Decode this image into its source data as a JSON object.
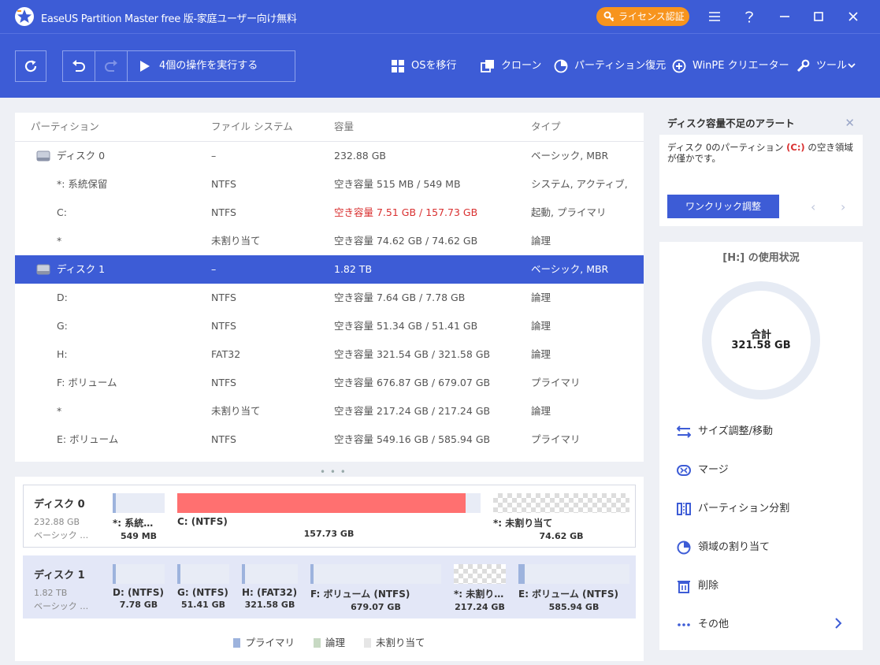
{
  "app": {
    "title": "EaseUS Partition Master free 版-家庭ユーザー向け無料",
    "license_label": "ライセンス認証"
  },
  "toolbar": {
    "execute_label": "4個の操作を実行する",
    "items": {
      "os_migrate": "OSを移行",
      "clone": "クローン",
      "partition_recovery": "パーティション復元",
      "winpe": "WinPE クリエーター",
      "tools": "ツール"
    }
  },
  "table": {
    "headers": {
      "partition": "パーティション",
      "filesystem": "ファイル システム",
      "capacity": "容量",
      "type": "タイプ"
    },
    "rows": [
      {
        "name": "ディスク 0",
        "fs": "–",
        "cap": "232.88 GB",
        "type": "ベーシック, MBR",
        "disk": true
      },
      {
        "name": "*: 系統保留",
        "fs": "NTFS",
        "cap": "空き容量 515 MB / 549 MB",
        "type": "システム, アクティブ, …"
      },
      {
        "name": "C:",
        "fs": "NTFS",
        "cap": "空き容量 7.51 GB / 157.73 GB",
        "type": "起動, プライマリ",
        "warn": true
      },
      {
        "name": "*",
        "fs": "未割り当て",
        "cap": "空き容量 74.62 GB / 74.62 GB",
        "type": "論理"
      },
      {
        "name": "ディスク 1",
        "fs": "–",
        "cap": "1.82 TB",
        "type": "ベーシック, MBR",
        "disk": true,
        "selected": true
      },
      {
        "name": "D:",
        "fs": "NTFS",
        "cap": "空き容量 7.64 GB / 7.78 GB",
        "type": "論理"
      },
      {
        "name": "G:",
        "fs": "NTFS",
        "cap": "空き容量 51.34 GB / 51.41 GB",
        "type": "論理"
      },
      {
        "name": "H:",
        "fs": "FAT32",
        "cap": "空き容量 321.54 GB / 321.58 GB",
        "type": "論理"
      },
      {
        "name": "F: ボリューム",
        "fs": "NTFS",
        "cap": "空き容量 676.87 GB / 679.07 GB",
        "type": "プライマリ"
      },
      {
        "name": "*",
        "fs": "未割り当て",
        "cap": "空き容量 217.24 GB / 217.24 GB",
        "type": "論理"
      },
      {
        "name": "E: ボリューム",
        "fs": "NTFS",
        "cap": "空き容量 549.16 GB / 585.94 GB",
        "type": "プライマリ"
      }
    ]
  },
  "diskmap": {
    "disk0": {
      "name": "ディスク 0",
      "size": "232.88 GB",
      "type": "ベーシック …",
      "segments": [
        {
          "label": "*: 系統…",
          "size": "549 MB",
          "used": 0.06,
          "kind": "primary"
        },
        {
          "label": "C: (NTFS)",
          "size": "157.73 GB",
          "used": 0.95,
          "kind": "warn"
        },
        {
          "label": "*: 未割り当て",
          "size": "74.62 GB",
          "used": 0,
          "kind": "unalloc"
        }
      ]
    },
    "disk1": {
      "name": "ディスク 1",
      "size": "1.82 TB",
      "type": "ベーシック …",
      "segments": [
        {
          "label": "D: (NTFS)",
          "size": "7.78 GB",
          "used": 0.02,
          "kind": "logical"
        },
        {
          "label": "G: (NTFS)",
          "size": "51.41 GB",
          "used": 0.01,
          "kind": "logical"
        },
        {
          "label": "H: (FAT32)",
          "size": "321.58 GB",
          "used": 0.01,
          "kind": "logical"
        },
        {
          "label": "F: ボリューム (NTFS)",
          "size": "679.07 GB",
          "used": 0.01,
          "kind": "primary"
        },
        {
          "label": "*: 未割り…",
          "size": "217.24 GB",
          "used": 0,
          "kind": "unalloc"
        },
        {
          "label": "E: ボリューム (NTFS)",
          "size": "585.94 GB",
          "used": 0.06,
          "kind": "primary"
        }
      ]
    },
    "legend": {
      "primary": "プライマリ",
      "logical": "論理",
      "unalloc": "未割り当て"
    }
  },
  "alert": {
    "title": "ディスク容量不足のアラート",
    "msg_before": "ディスク 0のパーティション ",
    "msg_drive": "(C:)",
    "msg_after": " の空き領域が僅かです。",
    "button": "ワンクリック調整"
  },
  "usage": {
    "title": "[H:] の使用状況",
    "total_label": "合計",
    "total_value": "321.58 GB",
    "used_fraction": 0.0001,
    "actions": {
      "resize": "サイズ調整/移動",
      "merge": "マージ",
      "split": "パーティション分割",
      "allocate": "領域の割り当て",
      "delete": "削除",
      "more": "その他"
    }
  },
  "colors": {
    "brand": "#3d5cd6",
    "license": "#f7941d",
    "warn_bar": "#ff7070",
    "primary_bar": "#9db3dd",
    "logical_bar": "#c7d9c3"
  }
}
